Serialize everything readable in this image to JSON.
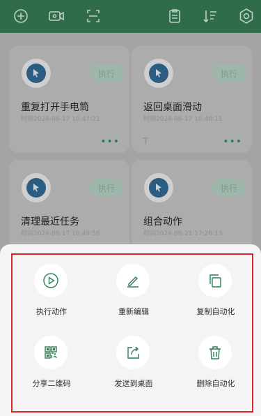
{
  "topbar": {
    "icons": [
      "add-circle-icon",
      "video-record-icon",
      "scan-frame-icon",
      "clipboard-icon",
      "sort-list-icon",
      "settings-hex-icon"
    ]
  },
  "cards": [
    {
      "title": "重复打开手电筒",
      "time": "时间2024-06-17 10:47:21",
      "run_label": "执行",
      "more": "•••",
      "pin": ""
    },
    {
      "title": "返回桌面滑动",
      "time": "时间2024-06-17 10:48:11",
      "run_label": "执行",
      "more": "•••",
      "pin": "⊤"
    },
    {
      "title": "清理最近任务",
      "time": "时间2024-06-17 10:49:56",
      "run_label": "执行",
      "more": "",
      "pin": ""
    },
    {
      "title": "组合动作",
      "time": "时间2024-06-21 17:26:13",
      "run_label": "执行",
      "more": "",
      "pin": ""
    }
  ],
  "sheet": {
    "actions": [
      {
        "label": "执行动作",
        "icon": "play-circle-icon"
      },
      {
        "label": "重新编辑",
        "icon": "pencil-icon"
      },
      {
        "label": "复制自动化",
        "icon": "copy-icon"
      },
      {
        "label": "分享二维码",
        "icon": "qrcode-icon"
      },
      {
        "label": "发送到桌面",
        "icon": "share-to-desktop-icon"
      },
      {
        "label": "删除自动化",
        "icon": "trash-icon"
      }
    ]
  },
  "colors": {
    "accent": "#2e7d55",
    "highlight_border": "#d9262e",
    "topbar": "#2e6c4a"
  }
}
